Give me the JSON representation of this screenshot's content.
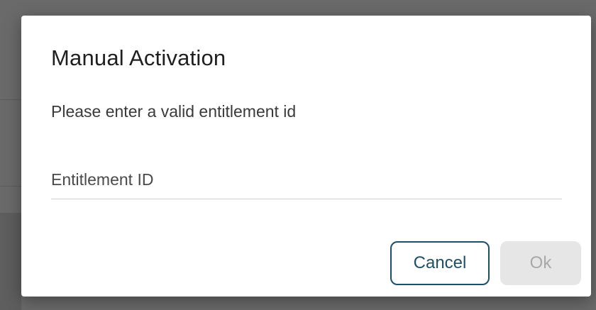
{
  "dialog": {
    "title": "Manual Activation",
    "message": "Please enter a valid entitlement id",
    "input": {
      "value": "",
      "placeholder": "Entitlement ID"
    },
    "buttons": {
      "cancel_label": "Cancel",
      "ok_label": "Ok",
      "ok_disabled": true
    }
  },
  "colors": {
    "accent": "#1d4f66",
    "disabled_bg": "#e6e6e6",
    "disabled_text": "#a8a8a8",
    "overlay": "#6a6a6a"
  }
}
